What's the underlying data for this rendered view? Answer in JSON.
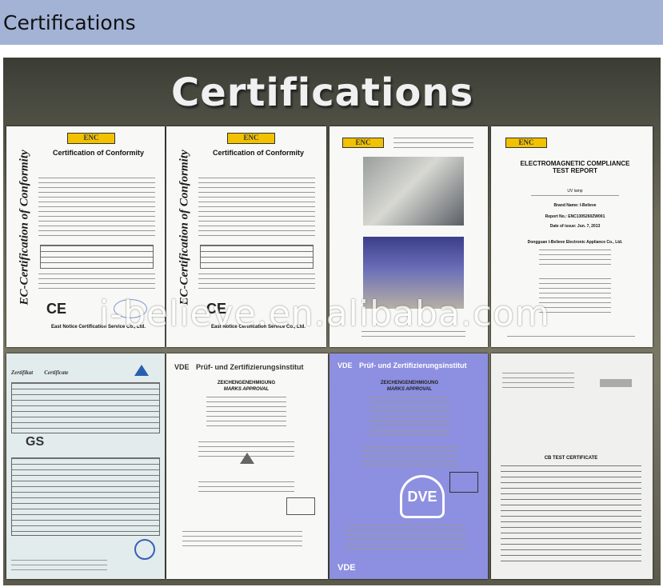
{
  "header": {
    "title": "Certifications"
  },
  "banner": {
    "title": "Certifications",
    "watermark": "i-believe.en.alibaba.com"
  },
  "docs": {
    "d1": {
      "logo": "ENC",
      "vertical": "EC-Certification of Conformity",
      "heading": "Certification of Conformity",
      "footer": "East Notice Certification Service Co., Ltd."
    },
    "d2": {
      "logo": "ENC",
      "vertical": "EC-Certification of Conformity",
      "heading": "Certification of Conformity",
      "footer": "East Notice Certification Service Co., Ltd."
    },
    "d3": {
      "logo": "ENC"
    },
    "d4": {
      "logo": "ENC",
      "heading": "ELECTROMAGNETIC COMPLIANCE TEST REPORT",
      "product": "UV lamp",
      "brand": "Brand Name: I-Believe",
      "report": "Report No.: ENC1305260ZW001",
      "date": "Date of issue: Jun. 7, 2013",
      "maker": "Dongguan I-Believe Electronic Appliance Co., Ltd."
    },
    "d5": {
      "title": "Zertifikat",
      "subtitle": "Certificate",
      "mark": "GS"
    },
    "d6": {
      "logo": "VDE",
      "institut": "Prüf- und Zertifizierungsinstitut",
      "heading": "ZEICHENGENEHMIGUNG",
      "subheading": "MARKS APPROVAL"
    },
    "d7": {
      "logo": "VDE",
      "institut": "Prüf- und Zertifizierungsinstitut",
      "heading": "ZEICHENGENEHMIGUNG",
      "subheading": "MARKS APPROVAL",
      "mark": "DVE",
      "footer": "VDE"
    },
    "d8": {
      "heading": "CB TEST CERTIFICATE"
    }
  }
}
